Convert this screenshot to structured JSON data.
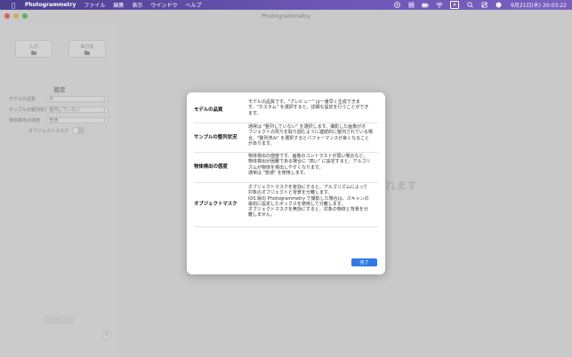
{
  "menubar": {
    "apple_icon": "apple-logo",
    "app_name": "Photogrammetry",
    "items": [
      "ファイル",
      "編集",
      "表示",
      "ウインドウ",
      "ヘルプ"
    ],
    "clock": "9月21日(木) 20:03:22",
    "input_indicator": "A"
  },
  "window": {
    "title": "Photogrammetry"
  },
  "sidebar": {
    "input_label": "入力",
    "output_label": "出力先",
    "settings_title": "設定",
    "quality_label": "モデルの品質",
    "quality_value": "中",
    "ordering_label": "サンプルの整列状況",
    "ordering_value": "整列していない",
    "sensitivity_label": "物体検出の感度",
    "sensitivity_value": "普通",
    "object_mask_label": "オブジェクトマスク",
    "object_mask_on": false,
    "help_label": "?"
  },
  "main": {
    "drop_text": "れます"
  },
  "help_sheet": {
    "rows": [
      {
        "term": "モデルの品質",
        "lines": [
          "モデルの品質です。\"プレビュー\" は一番早く生成できま",
          "す。\"カスタム\" を選択すると、詳細な設定を行うことができ",
          "ます。"
        ]
      },
      {
        "term": "サンプルの整列状況",
        "lines": [
          "通常は \"整列していない\" を選択します。撮影した画像がオ",
          "ブジェクトの周りを取り囲むように連続的に整列されている場",
          "合、\"整列済み\" を選択するとパフォーマンスが良くなること",
          "があります。"
        ]
      },
      {
        "term": "物体検出の感度",
        "lines": [
          "物体検出の感度です。画像のコントラストが弱い場合など、",
          "物体検出が困難である場合に \"高い\" に設定すると、アルゴリ",
          "ズムが物体を検出しやすくなります。",
          "通常は \"普通\" を使用します。"
        ]
      },
      {
        "term": "オブジェクトマスク",
        "lines": [
          "オブジェクトマスクを有効にすると、アルゴリズムによって",
          "対象のオブジェクトと背景を分離します。",
          "iOS 版の Photogrammetry で撮影した場合は、スキャンの",
          "最初に設定したボックスを使用して分離します。",
          "オブジェクトマスクを無効にすると、対象の物体と背景を分",
          "離しません。"
        ]
      }
    ],
    "done_label": "完了"
  }
}
